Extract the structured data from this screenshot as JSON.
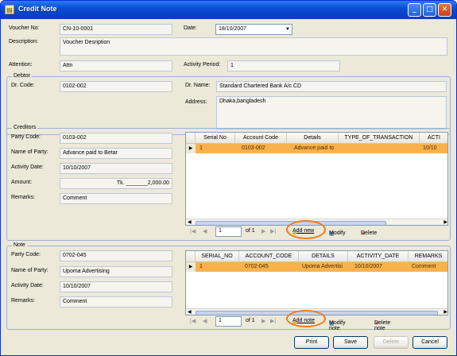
{
  "window": {
    "title": "Credit Note"
  },
  "header": {
    "voucher_no_label": "Voucher No:",
    "voucher_no": "CN-10-0001",
    "date_label": "Date:",
    "date": "18/10/2007",
    "description_label": "Description:",
    "description": "Voucher Desription",
    "attention_label": "Attention:",
    "attention": "Attn",
    "activity_period_label": "Activity Period:",
    "activity_period": "1"
  },
  "debtor": {
    "title": "Debtor",
    "dr_code_label": "Dr. Code:",
    "dr_code": "0102-002",
    "dr_name_label": "Dr. Name:",
    "dr_name": "Standard Chartered Bank A/c CD",
    "address_label": "Address:",
    "address": "Dhaka,bangladesh"
  },
  "creditors": {
    "title": "Creditors",
    "party_code_label": "Party Code:",
    "party_code": "0103-002",
    "name_of_party_label": "Name of Party:",
    "name_of_party": "Advance paid to Betar",
    "activity_date_label": "Activity Date:",
    "activity_date": "10/10/2007",
    "amount_label": "Amount:",
    "amount": "Tk. _______2,000.00",
    "remarks_label": "Remarks:",
    "remarks": "Comment",
    "grid": {
      "columns": [
        "Serial No",
        "Account Code",
        "Details",
        "TYPE_OF_TRANSACTION",
        "ACTI"
      ],
      "rows": [
        [
          "1",
          "0103-002",
          "Advance paid to",
          "",
          "10/10"
        ]
      ]
    },
    "nav": {
      "position": "1",
      "of": "of 1",
      "add": "Add new",
      "modify": "Modify",
      "delete": "Delete"
    }
  },
  "note": {
    "title": "Note",
    "party_code_label": "Party Code:",
    "party_code": "0702-045",
    "name_of_party_label": "Name of Party:",
    "name_of_party": "Upoma Advertising",
    "activity_date_label": "Activity Date:",
    "activity_date": "10/10/2007",
    "remarks_label": "Remarks:",
    "remarks": "Comment",
    "grid": {
      "columns": [
        "SERIAL_NO",
        "ACCOUNT_CODE",
        "DETAILS",
        "ACTIVITY_DATE",
        "REMARKS"
      ],
      "rows": [
        [
          "1",
          "0702-045",
          "Upoma Advertisi",
          "10/10/2007",
          "Comment"
        ]
      ]
    },
    "nav": {
      "position": "1",
      "of": "of 1",
      "add": "Add note",
      "modify": "Modify note",
      "delete": "Delete note"
    }
  },
  "footer": {
    "print": "Print",
    "save": "Save",
    "delete": "Delete",
    "cancel": "Cancel"
  },
  "colors": {
    "selected_row": "#f8b24c",
    "highlight_ring": "#f07b1c",
    "title_bar": "#0a4fd6"
  }
}
